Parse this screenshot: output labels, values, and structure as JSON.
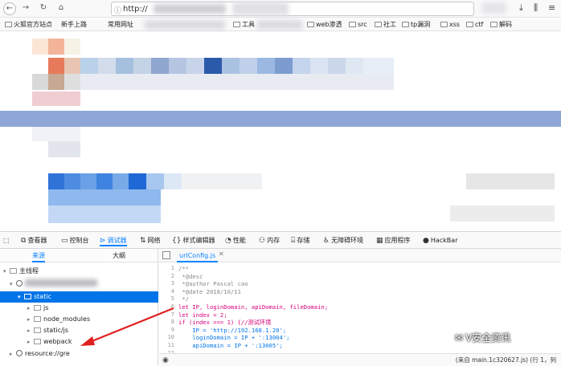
{
  "browser": {
    "url": "http://",
    "bookmarks": [
      "火狐官方站点",
      "新手上路",
      "常用网址",
      "工具",
      "web渗透",
      "src",
      "社工",
      "tp漏洞",
      "xss",
      "ctf",
      "解码"
    ]
  },
  "devtools": {
    "tabs": [
      {
        "label": "查看器",
        "icon": "inspector-icon"
      },
      {
        "label": "控制台",
        "icon": "console-icon"
      },
      {
        "label": "调试器",
        "icon": "debugger-icon",
        "active": true
      },
      {
        "label": "网络",
        "icon": "network-icon"
      },
      {
        "label": "样式编辑器",
        "icon": "style-editor-icon"
      },
      {
        "label": "性能",
        "icon": "performance-icon"
      },
      {
        "label": "内存",
        "icon": "memory-icon"
      },
      {
        "label": "存储",
        "icon": "storage-icon"
      },
      {
        "label": "无障碍环境",
        "icon": "accessibility-icon"
      },
      {
        "label": "应用程序",
        "icon": "application-icon"
      },
      {
        "label": "HackBar",
        "icon": "hackbar-icon"
      }
    ],
    "sidebar": {
      "tabs": [
        "来源",
        "大纲"
      ],
      "tree": [
        {
          "label": "主线程",
          "level": 0,
          "kind": "thread"
        },
        {
          "label": "",
          "level": 1,
          "kind": "globe"
        },
        {
          "label": "static",
          "level": 2,
          "kind": "folder",
          "selected": true
        },
        {
          "label": "js",
          "level": 3,
          "kind": "folder"
        },
        {
          "label": "node_modules",
          "level": 3,
          "kind": "folder"
        },
        {
          "label": "static/js",
          "level": 3,
          "kind": "folder"
        },
        {
          "label": "webpack",
          "level": 3,
          "kind": "folder"
        },
        {
          "label": "resource://gre",
          "level": 1,
          "kind": "globe"
        }
      ]
    },
    "editor": {
      "file_tab": "urlConfig.js",
      "lines": [
        {
          "n": "1",
          "text": "/**",
          "cls": "cm"
        },
        {
          "n": "2",
          "text": " *@desc",
          "cls": "cm"
        },
        {
          "n": "3",
          "text": " *@author Pascal cao",
          "cls": "cm"
        },
        {
          "n": "4",
          "text": " *@date 2018/10/11",
          "cls": "cm"
        },
        {
          "n": "5",
          "text": " */",
          "cls": "cm"
        },
        {
          "n": "6",
          "text": "let IP, loginDomain, apiDomain, fileDomain;",
          "cls": "kw"
        },
        {
          "n": "7",
          "text": "let index = 2;",
          "cls": "kw"
        },
        {
          "n": "8",
          "text": "if (index === 1) {//测试环境",
          "cls": "kw"
        },
        {
          "n": "9",
          "text": "    IP = 'http://192.168.1.20';",
          "cls": "str"
        },
        {
          "n": "10",
          "text": "    loginDomain = IP + ':13004';",
          "cls": "str"
        },
        {
          "n": "11",
          "text": "    apiDomain = IP + ':13005';",
          "cls": "str"
        },
        {
          "n": "12",
          "text": "",
          "cls": "cm"
        }
      ],
      "status": "(来自 main.1c320627.js) (行 1，列"
    }
  },
  "watermark": "V安全资讯"
}
